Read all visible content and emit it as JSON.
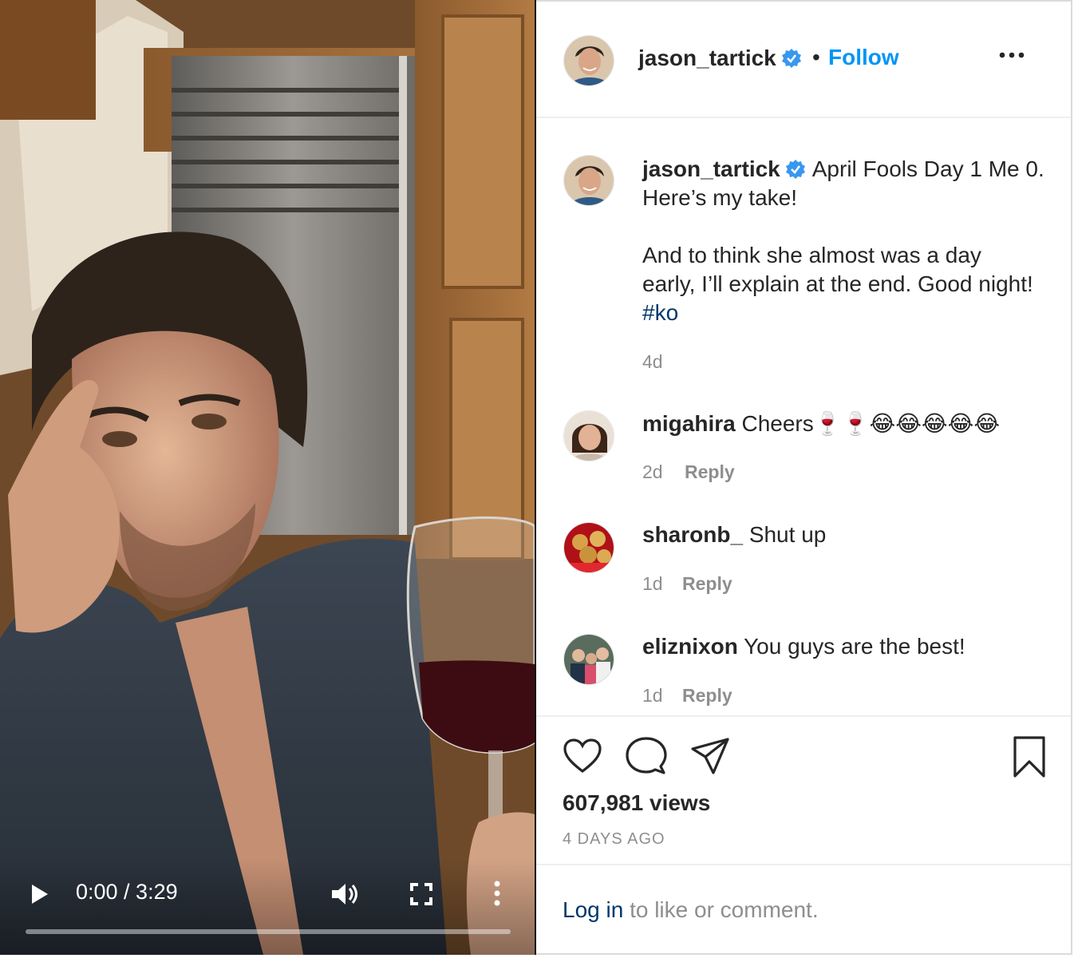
{
  "video": {
    "time": "0:00 / 3:29",
    "progress_fraction": 0.0
  },
  "header": {
    "username": "jason_tartick",
    "separator": "•",
    "follow_label": "Follow"
  },
  "caption": {
    "username": "jason_tartick",
    "line1": "April Fools Day 1 Me 0.",
    "line2": "Here’s my take!",
    "line3": "And to think she almost was a day",
    "line4": "early, I’ll explain at the end. Good night!",
    "hashtag": "#ko",
    "time": "4d"
  },
  "comments": [
    {
      "username": "migahira",
      "text": "Cheers🍷🍷😂😂😂😂😂",
      "time": "2d",
      "reply_label": "Reply"
    },
    {
      "username": "sharonb_",
      "text": "Shut up",
      "time": "1d",
      "reply_label": "Reply"
    },
    {
      "username": "eliznixon",
      "text": "You guys are the best!",
      "time": "1d",
      "reply_label": "Reply"
    }
  ],
  "actions": {
    "views": "607,981 views",
    "posted": "4 DAYS AGO"
  },
  "login": {
    "link": "Log in",
    "rest": " to like or comment."
  },
  "colors": {
    "follow": "#0095f6",
    "verified": "#3897f0",
    "hashtag": "#00376b",
    "secondary_text": "#8e8e8e"
  },
  "icons": [
    "play-icon",
    "volume-icon",
    "fullscreen-icon",
    "more-options-icon",
    "verified-badge-icon",
    "heart-icon",
    "comment-icon",
    "share-icon",
    "bookmark-icon"
  ]
}
